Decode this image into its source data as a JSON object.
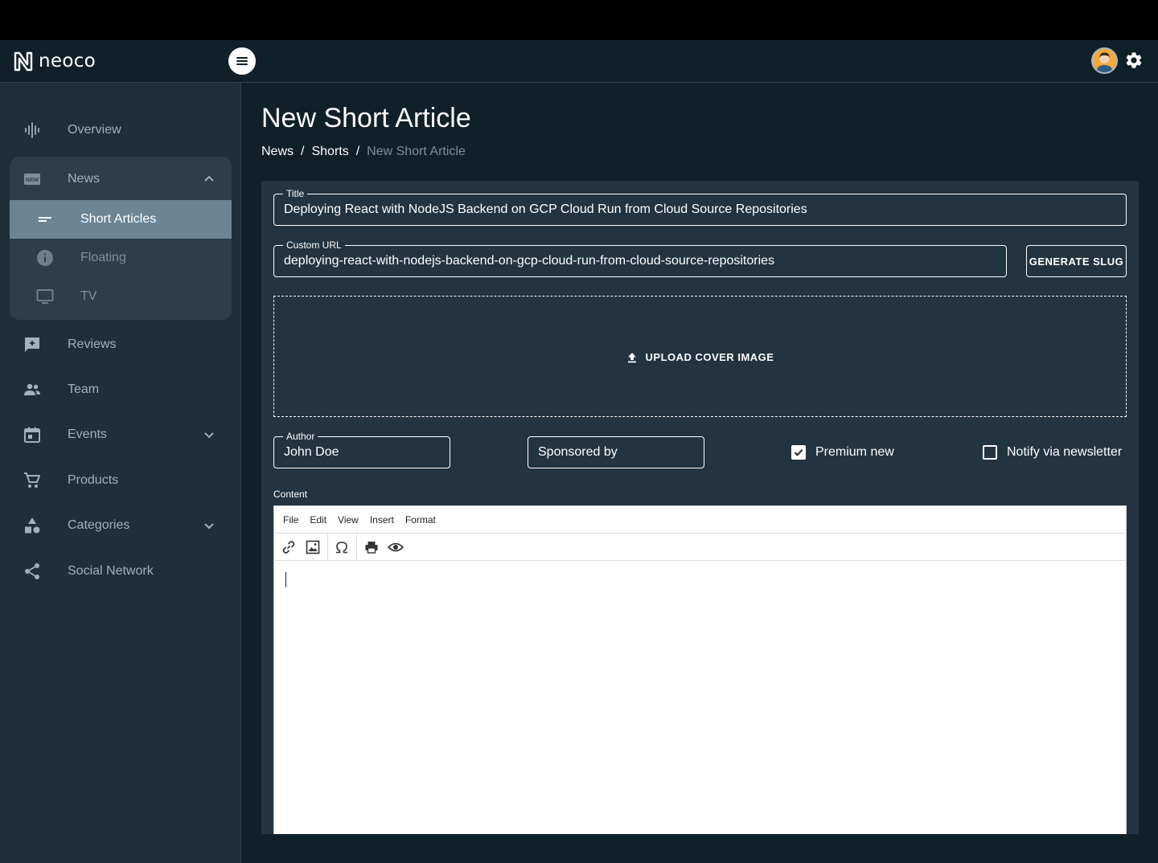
{
  "app": {
    "name": "neoco"
  },
  "sidebar": {
    "overview": "Overview",
    "news": "News",
    "news_sub": {
      "short_articles": "Short Articles",
      "floating": "Floating",
      "tv": "TV"
    },
    "reviews": "Reviews",
    "team": "Team",
    "events": "Events",
    "products": "Products",
    "categories": "Categories",
    "social_network": "Social Network"
  },
  "page": {
    "title": "New Short Article",
    "breadcrumb": {
      "news": "News",
      "shorts": "Shorts",
      "current": "New Short Article",
      "sep": "/"
    }
  },
  "form": {
    "title_label": "Title",
    "title_value": "Deploying React with NodeJS Backend on GCP Cloud Run from Cloud Source Repositories",
    "url_label": "Custom URL",
    "url_value": "deploying-react-with-nodejs-backend-on-gcp-cloud-run-from-cloud-source-repositories",
    "generate_slug": "GENERATE SLUG",
    "upload_cover": "UPLOAD COVER IMAGE",
    "author_label": "Author",
    "author_value": "John Doe",
    "sponsored_placeholder": "Sponsored by",
    "premium_label": "Premium new",
    "premium_checked": true,
    "newsletter_label": "Notify via newsletter",
    "newsletter_checked": false,
    "content_label": "Content"
  },
  "editor": {
    "menu": {
      "file": "File",
      "edit": "Edit",
      "view": "View",
      "insert": "Insert",
      "format": "Format"
    },
    "toolbar_icons": [
      "link-icon",
      "image-icon",
      "omega-icon",
      "print-icon",
      "preview-icon"
    ]
  },
  "colors": {
    "background": "#102029",
    "sidebar": "#1c2f3b",
    "card": "#22343f",
    "active_item": "#6b8595",
    "avatar": "#f4a93a"
  }
}
